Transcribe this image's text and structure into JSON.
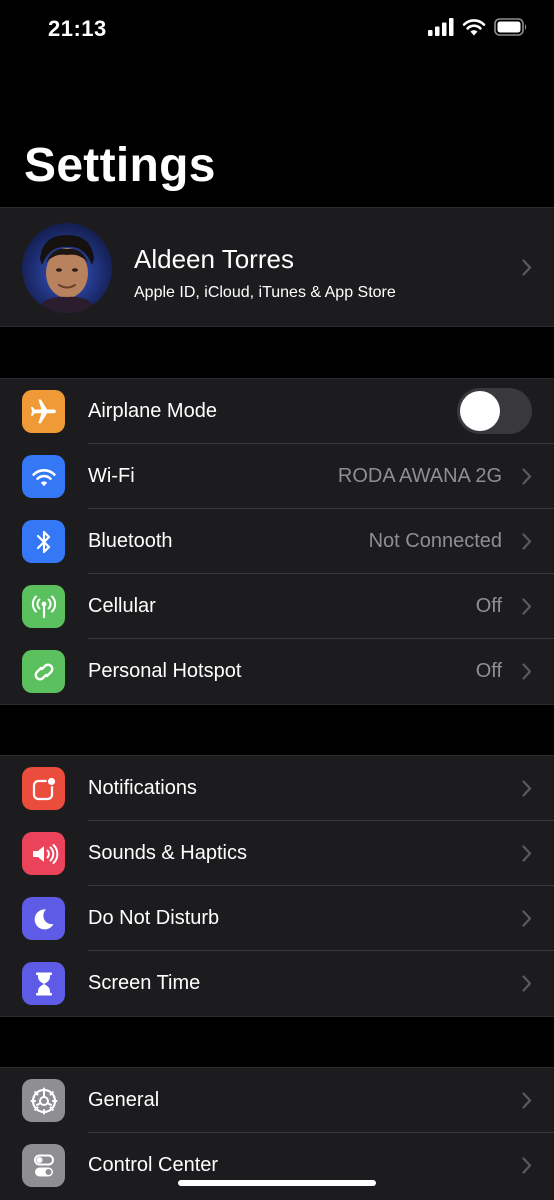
{
  "status_bar": {
    "time": "21:13",
    "icons": [
      "cellular-signal-icon",
      "wifi-icon",
      "battery-icon"
    ]
  },
  "page": {
    "title": "Settings"
  },
  "profile": {
    "name": "Aldeen Torres",
    "subtitle": "Apple ID, iCloud, iTunes & App Store"
  },
  "groups": [
    {
      "items": [
        {
          "label": "Airplane Mode",
          "icon": "airplane-icon",
          "icon_color": "#f09a37",
          "control": "toggle",
          "toggle_on": false
        },
        {
          "label": "Wi-Fi",
          "icon": "wifi-icon",
          "icon_color": "#3478f6",
          "value": "RODA AWANA 2G"
        },
        {
          "label": "Bluetooth",
          "icon": "bluetooth-icon",
          "icon_color": "#3478f6",
          "value": "Not Connected"
        },
        {
          "label": "Cellular",
          "icon": "cellular-antenna-icon",
          "icon_color": "#5ac15e",
          "value": "Off"
        },
        {
          "label": "Personal Hotspot",
          "icon": "hotspot-icon",
          "icon_color": "#5ac15e",
          "value": "Off"
        }
      ]
    },
    {
      "items": [
        {
          "label": "Notifications",
          "icon": "notifications-icon",
          "icon_color": "#eb4d3d"
        },
        {
          "label": "Sounds & Haptics",
          "icon": "speaker-icon",
          "icon_color": "#eb445a"
        },
        {
          "label": "Do Not Disturb",
          "icon": "moon-icon",
          "icon_color": "#5e5ce6"
        },
        {
          "label": "Screen Time",
          "icon": "hourglass-icon",
          "icon_color": "#5e5ce6"
        }
      ]
    },
    {
      "items": [
        {
          "label": "General",
          "icon": "gear-icon",
          "icon_color": "#8e8e93"
        },
        {
          "label": "Control Center",
          "icon": "switches-icon",
          "icon_color": "#8e8e93"
        }
      ]
    }
  ]
}
